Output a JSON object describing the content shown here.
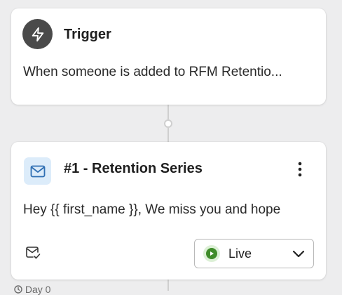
{
  "trigger": {
    "icon": "lightning-icon",
    "title": "Trigger",
    "description": "When someone is added to RFM Retentio..."
  },
  "email_step": {
    "icon": "envelope-icon",
    "title": "#1 - Retention Series",
    "preview": "Hey {{ first_name }}, We miss you and hope",
    "footer_icon": "envelope-check-icon",
    "more_icon": "vertical-dots-icon",
    "status": {
      "selected": "Live",
      "icon": "play-circle-icon",
      "chevron_icon": "chevron-down-icon"
    }
  },
  "delay": {
    "icon": "clock-icon",
    "label": "Day 0"
  },
  "colors": {
    "canvas_background": "#ededee",
    "card_background": "#ffffff",
    "trigger_icon_bg": "#4a4a4a",
    "email_icon_bg": "#dcecfa",
    "email_icon_stroke": "#2f6fb3",
    "live_green": "#3f8c2a",
    "live_green_bg": "#dcf0d6",
    "connector": "#cfcfcf"
  }
}
